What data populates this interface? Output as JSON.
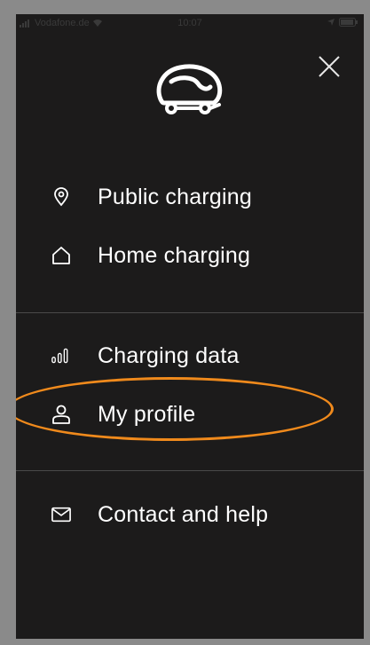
{
  "statusbar": {
    "carrier": "Vodafone.de",
    "time": "10:07"
  },
  "menu": {
    "items": [
      {
        "label": "Public charging",
        "icon": "location-pin-icon"
      },
      {
        "label": "Home charging",
        "icon": "home-icon"
      },
      {
        "label": "Charging data",
        "icon": "bar-chart-icon"
      },
      {
        "label": "My profile",
        "icon": "user-icon"
      },
      {
        "label": "Contact and help",
        "icon": "envelope-icon"
      }
    ]
  },
  "colors": {
    "background": "#1c1b1b",
    "text": "#ffffff",
    "divider": "#4a4a4a",
    "highlight": "#f08a1c",
    "outer": "#8a8a8a"
  }
}
